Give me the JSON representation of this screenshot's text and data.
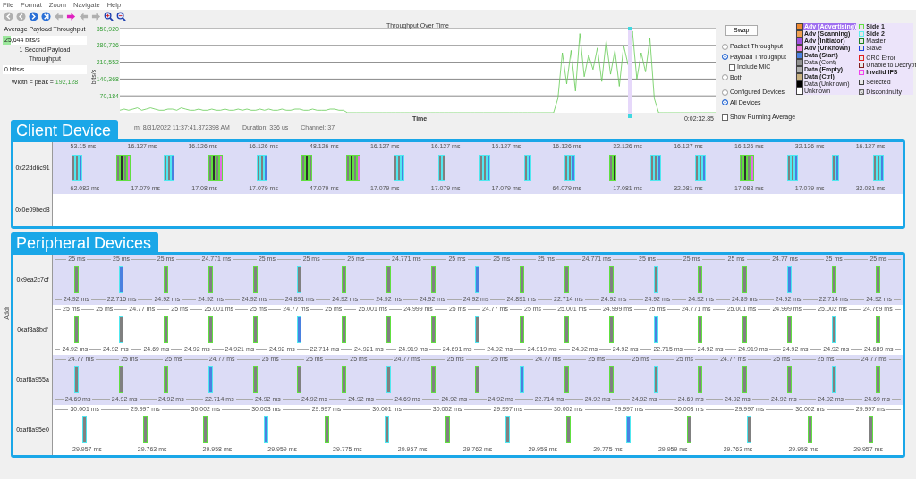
{
  "menu": [
    "File",
    "Format",
    "Zoom",
    "Navigate",
    "Help"
  ],
  "toolbar": [
    {
      "kind": "first",
      "disabled": true
    },
    {
      "kind": "prev",
      "disabled": true
    },
    {
      "kind": "next",
      "disabled": false
    },
    {
      "kind": "last",
      "disabled": false
    },
    {
      "kind": "back",
      "disabled": true
    },
    {
      "kind": "forward",
      "disabled": false
    },
    {
      "kind": "back",
      "disabled": true
    },
    {
      "kind": "forward",
      "disabled": true
    },
    {
      "kind": "zoom-in",
      "disabled": false
    },
    {
      "kind": "zoom-out",
      "disabled": false
    }
  ],
  "summary": {
    "avg": {
      "label": "Average Payload Throughput",
      "value": "25,644 bits/s",
      "level": 0.1
    },
    "sec": {
      "label": "1 Second Payload Throughput",
      "value": "0 bits/s"
    },
    "width_label": "Width = peak = ",
    "width_value": "192,128"
  },
  "chart": {
    "time_label": "0:02:32.85",
    "chart_data": {
      "type": "line",
      "title": "Throughput Over Time",
      "xlabel": "Time",
      "ylabel": "bits/s",
      "grid": true,
      "ylim": [
        0,
        350920
      ],
      "yticks": [
        {
          "value": 70184,
          "label": "70,184"
        },
        {
          "value": 140368,
          "label": "140,368"
        },
        {
          "value": 210552,
          "label": "210,552"
        },
        {
          "value": 280736,
          "label": "280,736"
        },
        {
          "value": 350920,
          "label": "350,920"
        }
      ],
      "series": [
        {
          "color": "#66cc55",
          "values": [
            10000,
            15000,
            10000,
            15000,
            20000,
            10000,
            15000,
            20000,
            15000,
            10000,
            10000,
            15000,
            15000,
            10000,
            20000,
            15000,
            10000,
            10000,
            15000,
            10000,
            10000,
            15000,
            10000,
            10000,
            15000,
            10000,
            10000,
            15000,
            10000,
            15000,
            10000,
            10000,
            15000,
            10000,
            15000,
            10000,
            10000,
            15000,
            10000,
            10000,
            15000,
            15000,
            10000,
            10000,
            15000,
            10000,
            10000,
            10000,
            15000,
            15000,
            10000,
            10000,
            0,
            0,
            0,
            0,
            0,
            0,
            0,
            0,
            0,
            0,
            0,
            0,
            0,
            0,
            0,
            0,
            0,
            0,
            0,
            0,
            0,
            0,
            0,
            0,
            0,
            0,
            0,
            0,
            0,
            0,
            0,
            0,
            0,
            0,
            0,
            0,
            0,
            0,
            0,
            0,
            0,
            0,
            0,
            0,
            0,
            0,
            0,
            0,
            60000,
            250000,
            120000,
            260000,
            90000,
            330000,
            150000,
            240000,
            180000,
            270000,
            130000,
            300000,
            160000,
            260000,
            110000,
            280000,
            200000,
            340000,
            140000,
            250000,
            170000,
            310000,
            60000,
            0,
            0,
            0,
            0,
            0,
            0,
            0,
            0,
            0,
            0,
            0,
            0,
            0,
            0
          ]
        }
      ]
    }
  },
  "options": {
    "swap": "Swap",
    "radios": [
      {
        "label": "Packet Throughput",
        "selected": false
      },
      {
        "label": "Payload Throughput",
        "selected": true
      },
      {
        "label": "Include MIC",
        "kind": "check",
        "checked": false
      },
      {
        "label": "Both",
        "selected": false
      },
      {
        "label": "Configured Devices",
        "selected": false
      },
      {
        "label": "All Devices",
        "selected": true
      },
      {
        "label": "Show Running Average",
        "kind": "check",
        "checked": false
      }
    ]
  },
  "legend": {
    "left": [
      {
        "label": "Adv (Advertising)",
        "color": "#f08a30",
        "bold": true,
        "selected": true
      },
      {
        "label": "Adv (Scanning)",
        "color": "#f0a050",
        "bold": true,
        "selected": false
      },
      {
        "label": "Adv (Initiator)",
        "color": "#a050e0",
        "bold": true,
        "selected": false
      },
      {
        "label": "Adv (Unknown)",
        "color": "#f080e0",
        "bold": true,
        "selected": false
      },
      {
        "label": "Data (Start)",
        "color": "#4a80e0",
        "bold": true,
        "selected": false
      },
      {
        "label": "Data (Cont)",
        "color": "#909090",
        "bold": false,
        "selected": false
      },
      {
        "label": "Data (Empty)",
        "color": "#b0b0b0",
        "bold": true,
        "selected": false
      },
      {
        "label": "Data (Ctrl)",
        "color": "#c8b080",
        "bold": true,
        "selected": false
      },
      {
        "label": "Data (Unknown)",
        "color": "#000000",
        "bold": false,
        "selected": false
      },
      {
        "label": "Unknown",
        "color": "#ffffff",
        "bold": false,
        "selected": false
      }
    ],
    "right": [
      {
        "kind": "outline",
        "label": "Side 1",
        "color": "#60e040",
        "bold": true,
        "selected": false
      },
      {
        "kind": "outline",
        "label": "Side 2",
        "color": "#60f0f0",
        "bold": true,
        "selected": false
      },
      {
        "kind": "outline",
        "label": "Master",
        "color": "#208020",
        "bold": false,
        "selected": false
      },
      {
        "kind": "outline",
        "label": "Slave",
        "color": "#2040e0",
        "bold": false,
        "selected": false
      },
      {
        "kind": "outline",
        "label": "CRC Error",
        "color": "#e02020",
        "bold": false,
        "selected": false
      },
      {
        "kind": "outline",
        "label": "Unable to Decrypt",
        "color": "#802020",
        "bold": false,
        "selected": false
      },
      {
        "kind": "outline",
        "label": "Invalid IFS",
        "color": "#f040f0",
        "bold": true,
        "selected": false
      },
      {
        "kind": "outline",
        "label": "Selected",
        "color": "#404040",
        "bold": false,
        "selected": false
      },
      {
        "kind": "cross",
        "label": "Discontinuity",
        "color": "#606060",
        "bold": false,
        "selected": false
      }
    ]
  },
  "status": [
    "m: 8/31/2022 11:37:41.872398 AM",
    "Duration: 336 us",
    "Channel: 37"
  ],
  "axis_label": "Addr",
  "groups": [
    {
      "callout": "Client Device",
      "tracks": [
        {
          "address": "0x22dd6c91",
          "top": [
            "53.15 ms",
            "16.127 ms",
            "16.126 ms",
            "16.126 ms",
            "48.126 ms",
            "16.127 ms",
            "16.127 ms",
            "16.127 ms",
            "16.126 ms",
            "32.126 ms",
            "16.127 ms",
            "16.126 ms",
            "32.126 ms",
            "16.127 ms"
          ],
          "bottom": [
            "62.082 ms",
            "17.079 ms",
            "17.08 ms",
            "17.079 ms",
            "47.079 ms",
            "17.079 ms",
            "17.079 ms",
            "17.079 ms",
            "64.079 ms",
            "17.081 ms",
            "32.081 ms",
            "17.083 ms",
            "17.079 ms",
            "32.081 ms"
          ],
          "bursts": [
            {
              "packets": [
                {
                  "kind": "side2"
                },
                {
                  "kind": "side2"
                },
                {
                  "kind": "start"
                }
              ]
            },
            {
              "packets": [
                {
                  "kind": "side1"
                },
                {
                  "kind": "data"
                },
                {
                  "kind": "side1"
                },
                {
                  "kind": "unknown"
                }
              ]
            },
            {
              "packets": [
                {
                  "kind": "side2"
                },
                {
                  "kind": "side2"
                },
                {
                  "kind": "start"
                }
              ]
            },
            {
              "packets": [
                {
                  "kind": "side1"
                },
                {
                  "kind": "data"
                },
                {
                  "kind": "side1"
                },
                {
                  "kind": "unknown"
                }
              ]
            },
            {
              "packets": [
                {
                  "kind": "side2"
                },
                {
                  "kind": "side2"
                },
                {
                  "kind": "start"
                }
              ]
            },
            {
              "packets": [
                {
                  "kind": "side1"
                },
                {
                  "kind": "data"
                },
                {
                  "kind": "side1"
                }
              ]
            },
            {
              "packets": [
                {
                  "kind": "side1"
                },
                {
                  "kind": "data"
                },
                {
                  "kind": "side1"
                },
                {
                  "kind": "unknown"
                }
              ]
            },
            {
              "packets": [
                {
                  "kind": "side2"
                },
                {
                  "kind": "side2"
                },
                {
                  "kind": "start"
                }
              ]
            },
            {
              "packets": [
                {
                  "kind": "side2"
                },
                {
                  "kind": "side2"
                }
              ]
            },
            {
              "packets": [
                {
                  "kind": "side2"
                },
                {
                  "kind": "side2"
                },
                {
                  "kind": "start"
                }
              ]
            },
            {
              "packets": [
                {
                  "kind": "side2"
                },
                {
                  "kind": "start"
                }
              ]
            },
            {
              "packets": [
                {
                  "kind": "side2"
                },
                {
                  "kind": "side2"
                },
                {
                  "kind": "start"
                }
              ]
            },
            {
              "packets": [
                {
                  "kind": "side1"
                },
                {
                  "kind": "data"
                }
              ]
            },
            {
              "packets": [
                {
                  "kind": "side2"
                },
                {
                  "kind": "side2"
                },
                {
                  "kind": "start"
                }
              ]
            },
            {
              "packets": [
                {
                  "kind": "side2"
                },
                {
                  "kind": "side2"
                },
                {
                  "kind": "start"
                }
              ]
            },
            {
              "packets": [
                {
                  "kind": "side1"
                },
                {
                  "kind": "data"
                },
                {
                  "kind": "side1"
                },
                {
                  "kind": "unknown"
                }
              ]
            },
            {
              "packets": [
                {
                  "kind": "side2"
                },
                {
                  "kind": "side2"
                },
                {
                  "kind": "start"
                }
              ]
            },
            {
              "packets": [
                {
                  "kind": "side2"
                },
                {
                  "kind": "start"
                }
              ]
            },
            {
              "packets": [
                {
                  "kind": "side2"
                },
                {
                  "kind": "side2"
                },
                {
                  "kind": "start"
                }
              ]
            }
          ]
        },
        {
          "address": "0x0e09bed8"
        }
      ]
    },
    {
      "callout": "Peripheral Devices",
      "tracks": [
        {
          "address": "0x9ea2c7cf",
          "top": [
            "25 ms",
            "25 ms",
            "25 ms",
            "24.771 ms",
            "25 ms",
            "25 ms",
            "25 ms",
            "24.771 ms",
            "25 ms",
            "25 ms",
            "25 ms",
            "24.771 ms",
            "25 ms",
            "25 ms",
            "25 ms",
            "24.77 ms",
            "25 ms",
            "25 ms"
          ],
          "bottom": [
            "24.92 ms",
            "22.715 ms",
            "24.92 ms",
            "24.92 ms",
            "24.92 ms",
            "24.891 ms",
            "24.92 ms",
            "24.92 ms",
            "24.92 ms",
            "24.92 ms",
            "24.891 ms",
            "22.714 ms",
            "24.92 ms",
            "24.92 ms",
            "24.92 ms",
            "24.89 ms",
            "24.92 ms",
            "22.714 ms",
            "24.92 ms"
          ],
          "packets": [
            {
              "kind": "side1"
            },
            {
              "kind": "start"
            },
            {
              "kind": "side1"
            },
            {
              "kind": "side1"
            },
            {
              "kind": "side1"
            },
            {
              "kind": "side2"
            },
            {
              "kind": "side1"
            },
            {
              "kind": "side1"
            },
            {
              "kind": "side1"
            },
            {
              "kind": "start"
            },
            {
              "kind": "side1"
            },
            {
              "kind": "side1"
            },
            {
              "kind": "side1"
            },
            {
              "kind": "side2"
            },
            {
              "kind": "side1"
            },
            {
              "kind": "side1"
            },
            {
              "kind": "start"
            },
            {
              "kind": "side1"
            },
            {
              "kind": "side1"
            }
          ]
        },
        {
          "address": "0xaf8a8bdf",
          "top": [
            "25 ms",
            "25 ms",
            "24.77 ms",
            "25 ms",
            "25.001 ms",
            "25 ms",
            "24.77 ms",
            "25 ms",
            "25.001 ms",
            "24.999 ms",
            "25 ms",
            "24.77 ms",
            "25 ms",
            "25.001 ms",
            "24.999 ms",
            "25 ms",
            "24.771 ms",
            "25.001 ms",
            "24.999 ms",
            "25.002 ms",
            "24.769 ms"
          ],
          "bottom": [
            "24.92 ms",
            "24.92 ms",
            "24.69 ms",
            "24.92 ms",
            "24.921 ms",
            "24.92 ms",
            "22.714 ms",
            "24.921 ms",
            "24.919 ms",
            "24.691 ms",
            "24.92 ms",
            "24.919 ms",
            "24.92 ms",
            "24.92 ms",
            "22.715 ms",
            "24.92 ms",
            "24.919 ms",
            "24.92 ms",
            "24.92 ms",
            "24.689 ms"
          ],
          "packets": [
            {
              "kind": "side1"
            },
            {
              "kind": "side2"
            },
            {
              "kind": "side1"
            },
            {
              "kind": "side1"
            },
            {
              "kind": "side1"
            },
            {
              "kind": "start"
            },
            {
              "kind": "side1"
            },
            {
              "kind": "side1"
            },
            {
              "kind": "side1"
            },
            {
              "kind": "side2"
            },
            {
              "kind": "side1"
            },
            {
              "kind": "side1"
            },
            {
              "kind": "side1"
            },
            {
              "kind": "start"
            },
            {
              "kind": "side1"
            },
            {
              "kind": "side1"
            },
            {
              "kind": "side1"
            },
            {
              "kind": "side2"
            },
            {
              "kind": "side1"
            }
          ]
        },
        {
          "address": "0xaf8a955a",
          "top": [
            "24.77 ms",
            "25 ms",
            "25 ms",
            "24.77 ms",
            "25 ms",
            "25 ms",
            "25 ms",
            "24.77 ms",
            "25 ms",
            "25 ms",
            "24.77 ms",
            "25 ms",
            "25 ms",
            "25 ms",
            "24.77 ms",
            "25 ms",
            "25 ms",
            "24.77 ms"
          ],
          "bottom": [
            "24.69 ms",
            "24.92 ms",
            "24.92 ms",
            "22.714 ms",
            "24.92 ms",
            "24.92 ms",
            "24.92 ms",
            "24.69 ms",
            "24.92 ms",
            "24.92 ms",
            "22.714 ms",
            "24.92 ms",
            "24.92 ms",
            "24.69 ms",
            "24.92 ms",
            "24.92 ms",
            "24.92 ms",
            "24.69 ms"
          ],
          "packets": [
            {
              "kind": "side2"
            },
            {
              "kind": "side1"
            },
            {
              "kind": "side1"
            },
            {
              "kind": "start"
            },
            {
              "kind": "side1"
            },
            {
              "kind": "side1"
            },
            {
              "kind": "side1"
            },
            {
              "kind": "side2"
            },
            {
              "kind": "side1"
            },
            {
              "kind": "side1"
            },
            {
              "kind": "start"
            },
            {
              "kind": "side1"
            },
            {
              "kind": "side1"
            },
            {
              "kind": "side2"
            },
            {
              "kind": "side1"
            },
            {
              "kind": "side1"
            },
            {
              "kind": "side1"
            },
            {
              "kind": "side2"
            },
            {
              "kind": "side1"
            }
          ]
        },
        {
          "address": "0xaf8a95e0",
          "top": [
            "30.001 ms",
            "29.997 ms",
            "30.002 ms",
            "30.003 ms",
            "29.997 ms",
            "30.001 ms",
            "30.002 ms",
            "29.997 ms",
            "30.002 ms",
            "29.997 ms",
            "30.003 ms",
            "29.997 ms",
            "30.002 ms",
            "29.997 ms"
          ],
          "bottom": [
            "29.957 ms",
            "29.763 ms",
            "29.958 ms",
            "29.959 ms",
            "29.775 ms",
            "29.957 ms",
            "29.762 ms",
            "29.958 ms",
            "29.775 ms",
            "29.959 ms",
            "29.763 ms",
            "29.958 ms",
            "29.957 ms"
          ],
          "packets": [
            {
              "kind": "side2"
            },
            {
              "kind": "side1"
            },
            {
              "kind": "side1"
            },
            {
              "kind": "start"
            },
            {
              "kind": "side1"
            },
            {
              "kind": "side2"
            },
            {
              "kind": "side1"
            },
            {
              "kind": "side2"
            },
            {
              "kind": "side1"
            },
            {
              "kind": "start"
            },
            {
              "kind": "side1"
            },
            {
              "kind": "side2"
            },
            {
              "kind": "side1"
            },
            {
              "kind": "side1"
            }
          ]
        }
      ]
    }
  ]
}
